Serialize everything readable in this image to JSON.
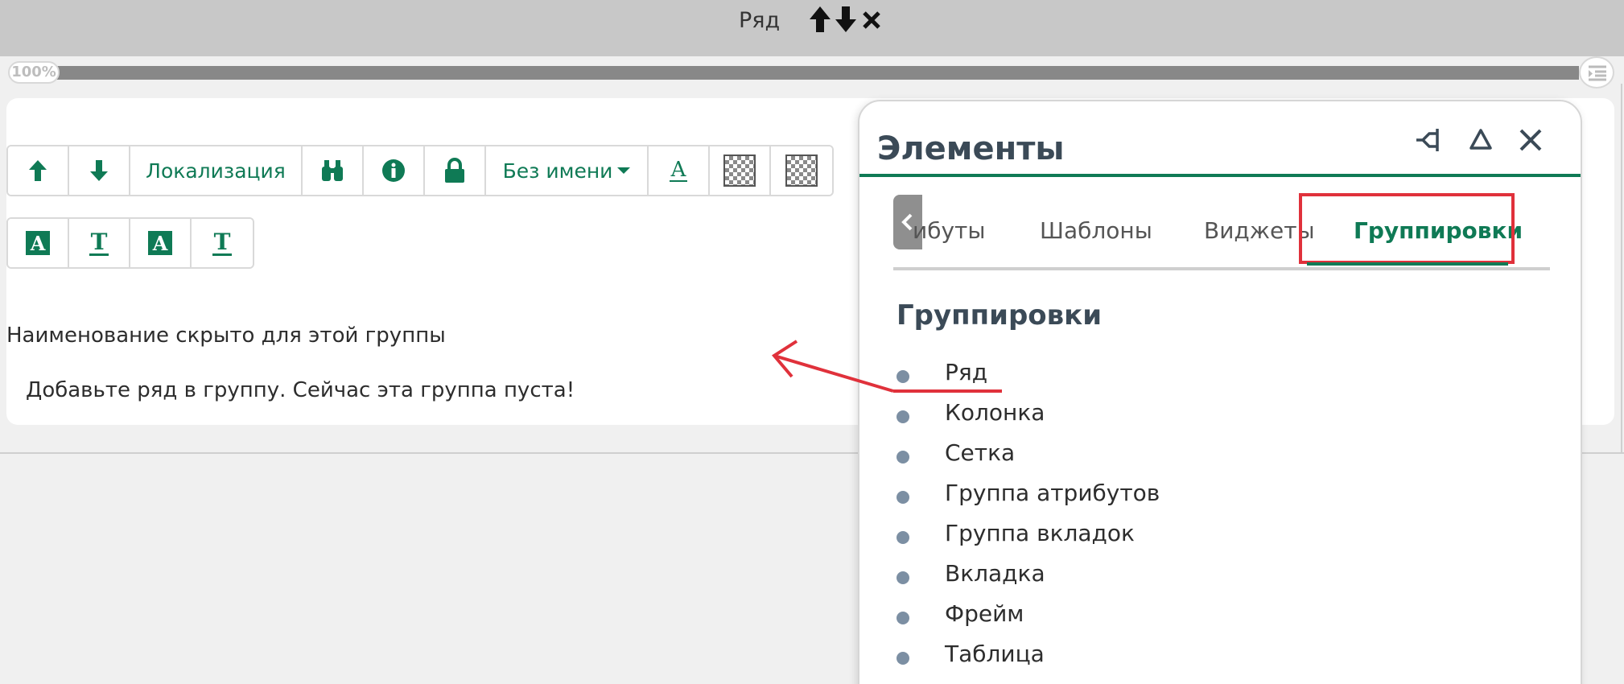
{
  "topbar": {
    "title": "Ряд",
    "controls": [
      "arrow-up-icon",
      "arrow-down-icon",
      "close-icon"
    ]
  },
  "zoom": {
    "label": "100%",
    "value_percent": 100
  },
  "toolbar": {
    "localization_label": "Локализация",
    "name_dropdown_label": "Без имени"
  },
  "messages": {
    "hidden_name": "Наименование скрыто для этой группы",
    "empty_group": "Добавьте ряд в группу. Сейчас эта группа пуста!"
  },
  "panel": {
    "title": "Элементы",
    "tabs": [
      {
        "label": "ибуты"
      },
      {
        "label": "Шаблоны"
      },
      {
        "label": "Виджеты"
      },
      {
        "label": "Группировки",
        "active": true
      }
    ],
    "section_title": "Группировки",
    "items": [
      {
        "label": "Ряд"
      },
      {
        "label": "Колонка"
      },
      {
        "label": "Сетка"
      },
      {
        "label": "Группа атрибутов"
      },
      {
        "label": "Группа вкладок"
      },
      {
        "label": "Вкладка"
      },
      {
        "label": "Фрейм"
      },
      {
        "label": "Таблица"
      }
    ]
  },
  "colors": {
    "accent": "#0f7a55",
    "highlight": "#e0313b",
    "bullet": "#7c8fa3",
    "heading": "#3b4a57"
  }
}
